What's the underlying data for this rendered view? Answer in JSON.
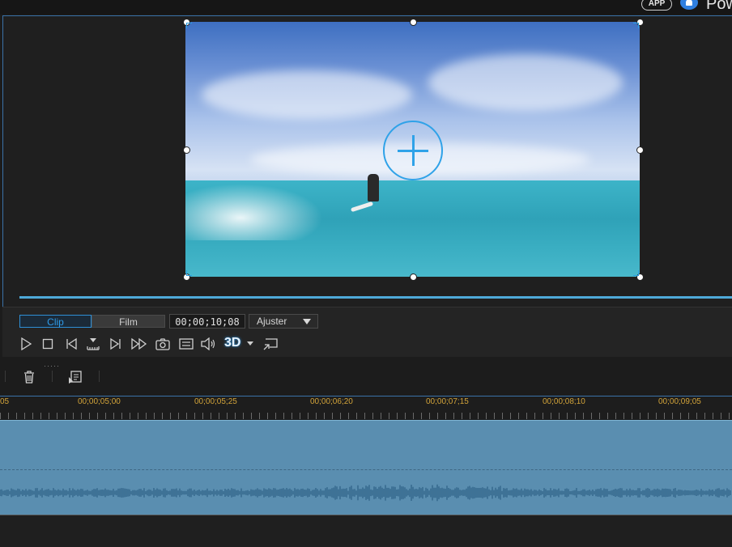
{
  "header": {
    "app_badge": "APP",
    "brand_text": "Pow"
  },
  "preview": {
    "video_description_icon": "add-circle-icon"
  },
  "controls": {
    "mode_clip": "Clip",
    "mode_film": "Film",
    "timecode": "00;00;10;08",
    "fit_select": "Ajuster",
    "three_d_label": "3D"
  },
  "toolbar": {
    "icons": [
      "trash-icon",
      "subtitle-edit-icon"
    ]
  },
  "timeline": {
    "ruler_labels": [
      "05",
      "00;00;05;00",
      "00;00;05;25",
      "00;00;06;20",
      "00;00;07;15",
      "00;00;08;10",
      "00;00;09;05"
    ]
  },
  "colors": {
    "accent": "#2e8fd6",
    "timecode_label": "#d3a43a",
    "track": "#5a8eb0"
  }
}
